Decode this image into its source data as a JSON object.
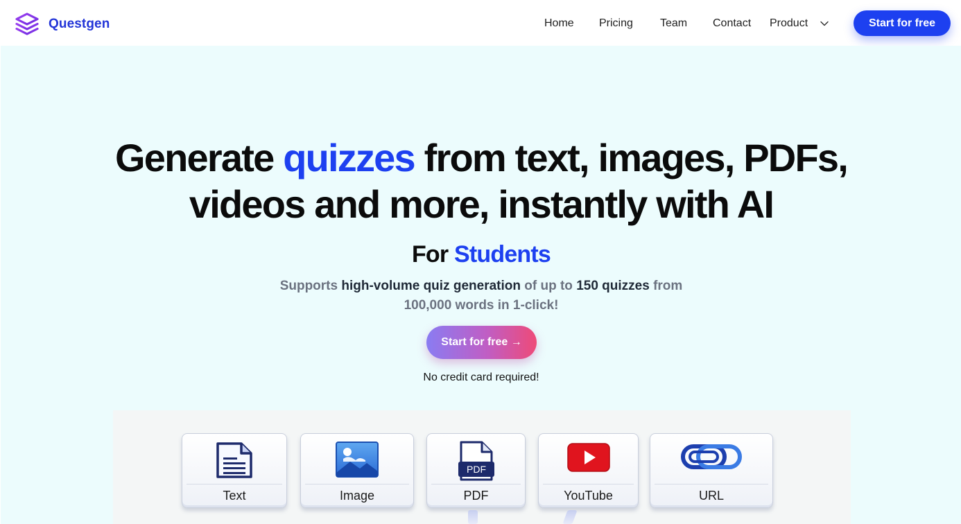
{
  "brand": {
    "name": "Questgen",
    "logo_icon": "stacked-layers-icon",
    "color": "#2335d8"
  },
  "nav": {
    "links": [
      "Home",
      "Pricing",
      "Team",
      "Contact"
    ],
    "product_label": "Product",
    "product_icon": "chevron-down-icon",
    "cta_label": "Start for free",
    "cta_color": "#1d40f0"
  },
  "hero": {
    "headline_part1": "Generate ",
    "headline_accent": "quizzes",
    "headline_part2": " from text, images, PDFs,",
    "headline_line2": "videos and more, instantly with AI",
    "subhead_prefix": "For ",
    "subhead_accent": "Students",
    "support_1": "Supports ",
    "support_2": "high-volume quiz generation",
    "support_3": " of up to ",
    "support_4": "150 quizzes",
    "support_5": " from 100,000 words in 1-click!",
    "cta_label": "Start for free →",
    "note": "No credit card required!",
    "background": "#ecfcfd",
    "accent_color": "#1d40f0"
  },
  "sources": [
    {
      "label": "Text",
      "icon": "document-icon"
    },
    {
      "label": "Image",
      "icon": "picture-icon"
    },
    {
      "label": "PDF",
      "icon": "pdf-file-icon",
      "badge": "PDF"
    },
    {
      "label": "YouTube",
      "icon": "youtube-play-icon"
    },
    {
      "label": "URL",
      "icon": "link-icon"
    }
  ]
}
